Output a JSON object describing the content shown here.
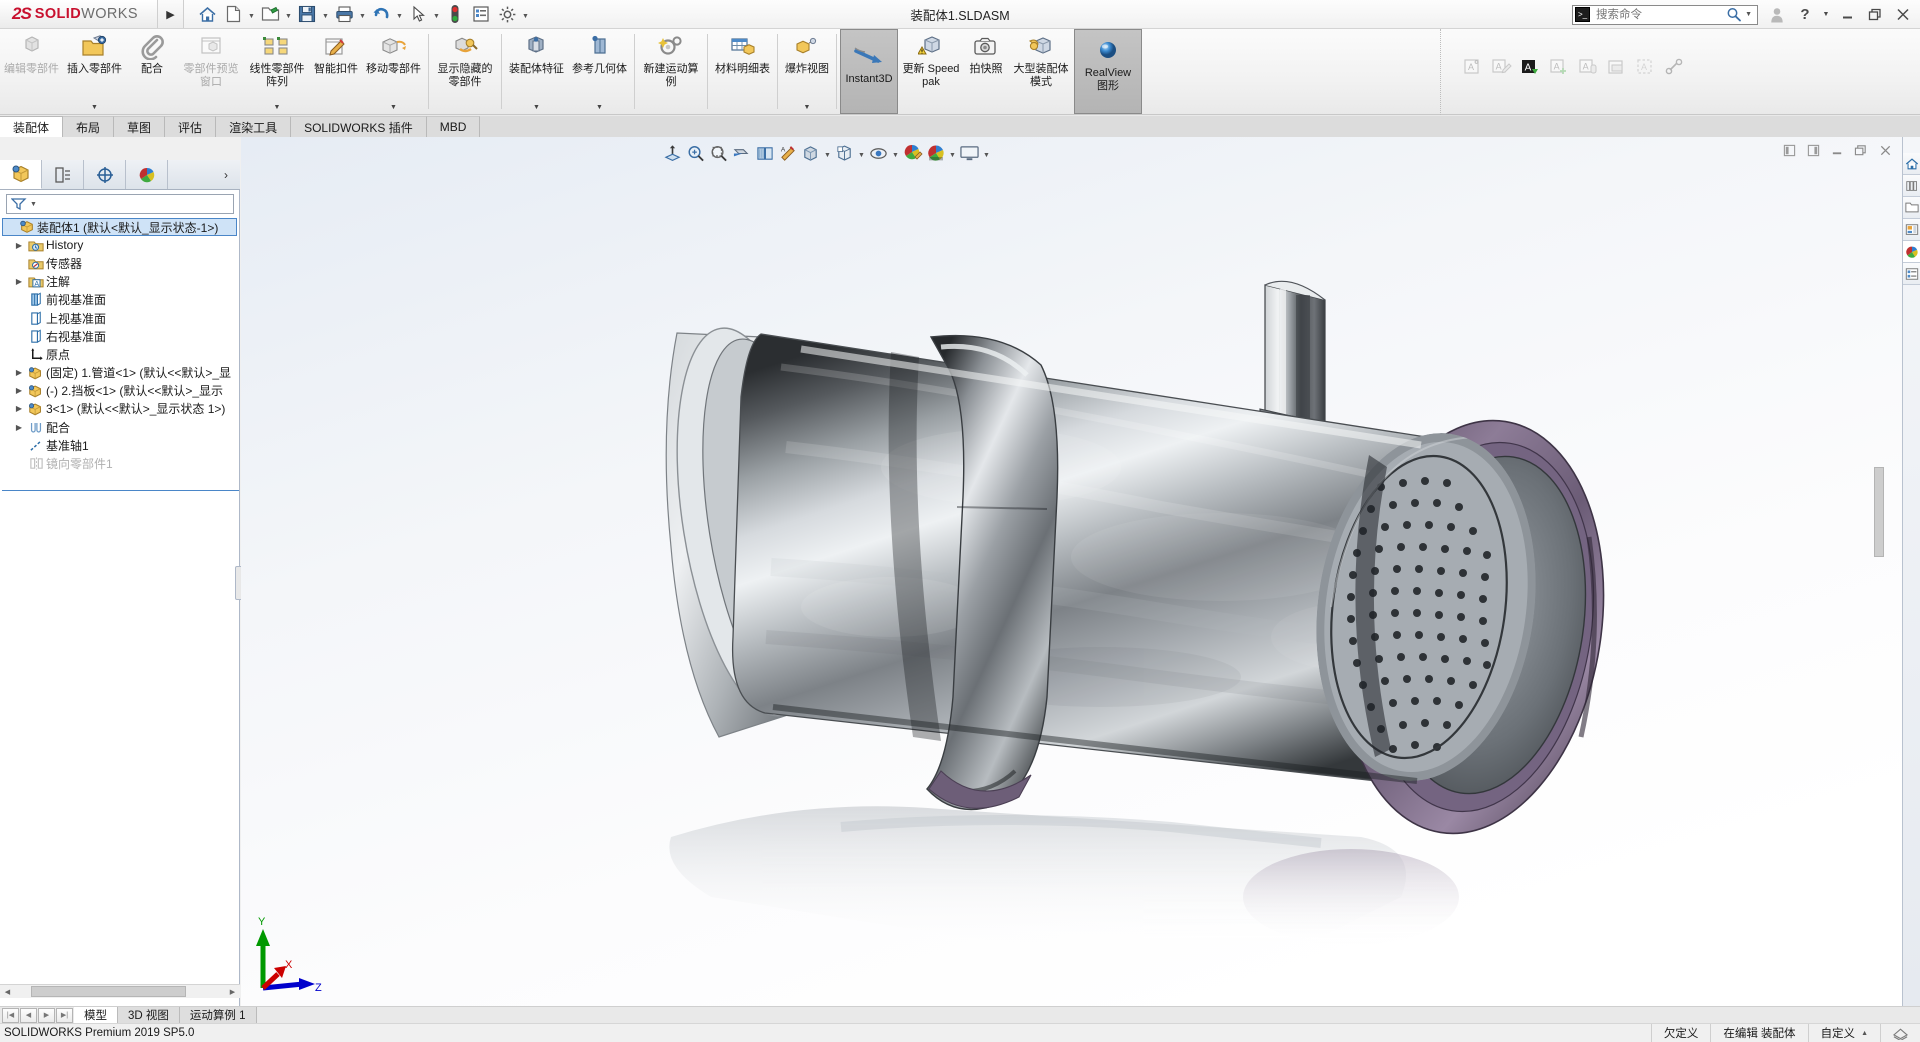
{
  "app": {
    "brand_ds": "2S",
    "brand_part1": "SOLID",
    "brand_part2": "WORKS",
    "document_title": "装配体1.SLDASM",
    "version_text": "SOLIDWORKS Premium 2019 SP5.0"
  },
  "quick_access": [
    {
      "name": "home-icon",
      "label": "主页"
    },
    {
      "name": "new-document-icon",
      "label": "新建"
    },
    {
      "name": "open-icon",
      "label": "打开"
    },
    {
      "name": "save-icon",
      "label": "保存"
    },
    {
      "name": "print-icon",
      "label": "打印"
    },
    {
      "name": "undo-icon",
      "label": "撤销"
    },
    {
      "name": "select-cursor-icon",
      "label": "选择"
    },
    {
      "name": "rebuild-icon",
      "label": "重建模型"
    },
    {
      "name": "options-list-icon",
      "label": "文件属性"
    },
    {
      "name": "gear-icon",
      "label": "选项"
    }
  ],
  "search": {
    "placeholder": "搜索命令",
    "value": ""
  },
  "window_controls": {
    "profile": "用户",
    "help": "?",
    "minimize": "—",
    "restore": "❐",
    "close": "✕"
  },
  "ribbon": {
    "groups": [
      {
        "items": [
          {
            "label": "编辑零部件",
            "icon": "edit-component-icon",
            "disabled": true,
            "dropdown": false,
            "selected": false
          },
          {
            "label": "插入零部件",
            "icon": "insert-component-icon",
            "disabled": false,
            "dropdown": true,
            "selected": false
          },
          {
            "label": "配合",
            "icon": "mate-paperclip-icon",
            "disabled": false,
            "dropdown": false,
            "selected": false
          },
          {
            "label": "零部件预览窗口",
            "icon": "component-preview-icon",
            "disabled": true,
            "dropdown": false,
            "selected": false
          },
          {
            "label": "线性零部件阵列",
            "icon": "linear-component-pattern-icon",
            "disabled": false,
            "dropdown": true,
            "selected": false
          },
          {
            "label": "智能扣件",
            "icon": "smart-fasteners-icon",
            "disabled": false,
            "dropdown": false,
            "selected": false
          },
          {
            "label": "移动零部件",
            "icon": "move-component-icon",
            "disabled": false,
            "dropdown": true,
            "selected": false
          }
        ]
      },
      {
        "items": [
          {
            "label": "显示隐藏的零部件",
            "icon": "show-hidden-components-icon",
            "disabled": false,
            "dropdown": false,
            "selected": false
          }
        ]
      },
      {
        "items": [
          {
            "label": "装配体特征",
            "icon": "assembly-feature-icon",
            "disabled": false,
            "dropdown": true,
            "selected": false
          },
          {
            "label": "参考几何体",
            "icon": "reference-geometry-icon",
            "disabled": false,
            "dropdown": true,
            "selected": false
          }
        ]
      },
      {
        "items": [
          {
            "label": "新建运动算例",
            "icon": "new-motion-study-icon",
            "disabled": false,
            "dropdown": false,
            "selected": false
          }
        ]
      },
      {
        "items": [
          {
            "label": "材料明细表",
            "icon": "bill-of-materials-icon",
            "disabled": false,
            "dropdown": false,
            "selected": false
          }
        ]
      },
      {
        "items": [
          {
            "label": "爆炸视图",
            "icon": "exploded-view-icon",
            "disabled": false,
            "dropdown": true,
            "selected": false
          }
        ]
      },
      {
        "items": [
          {
            "label": "Instant3D",
            "icon": "instant3d-icon",
            "disabled": false,
            "dropdown": false,
            "selected": true
          }
        ]
      },
      {
        "items": [
          {
            "label": "更新 Speedpak",
            "icon": "update-speedpak-icon",
            "disabled": false,
            "dropdown": false,
            "selected": false
          },
          {
            "label": "拍快照",
            "icon": "take-snapshot-icon",
            "disabled": false,
            "dropdown": false,
            "selected": false
          },
          {
            "label": "大型装配体模式",
            "icon": "large-assembly-mode-icon",
            "disabled": false,
            "dropdown": false,
            "selected": false
          },
          {
            "label": "RealView 图形",
            "icon": "realview-graphics-icon",
            "disabled": false,
            "dropdown": false,
            "selected": true
          }
        ]
      }
    ],
    "annotation_tools": [
      {
        "name": "new-note-icon",
        "disabled": true
      },
      {
        "name": "edit-note-icon",
        "disabled": true
      },
      {
        "name": "auto-note-icon",
        "disabled": false
      },
      {
        "name": "add-note-icon",
        "disabled": true
      },
      {
        "name": "note-properties-icon",
        "disabled": true
      },
      {
        "name": "print-note-icon",
        "disabled": true
      },
      {
        "name": "note-area-icon",
        "disabled": true
      },
      {
        "name": "link-note-icon",
        "disabled": true
      }
    ]
  },
  "command_tabs": [
    {
      "label": "装配体",
      "active": true
    },
    {
      "label": "布局",
      "active": false
    },
    {
      "label": "草图",
      "active": false
    },
    {
      "label": "评估",
      "active": false
    },
    {
      "label": "渲染工具",
      "active": false
    },
    {
      "label": "SOLIDWORKS 插件",
      "active": false
    },
    {
      "label": "MBD",
      "active": false
    }
  ],
  "feature_manager": {
    "tabs": [
      {
        "name": "feature-tree-tab",
        "label": "FeatureManager 设计树",
        "active": true
      },
      {
        "name": "property-manager-tab",
        "label": "PropertyManager",
        "active": false
      },
      {
        "name": "configuration-manager-tab",
        "label": "ConfigurationManager",
        "active": false
      },
      {
        "name": "display-manager-tab",
        "label": "DisplayManager",
        "active": false
      }
    ],
    "filter_placeholder": "",
    "tree": [
      {
        "label": "装配体1  (默认<默认_显示状态-1>)",
        "icon": "assembly-icon",
        "indent": 0,
        "expand": "",
        "selected": true,
        "greyed": false
      },
      {
        "label": "History",
        "icon": "history-icon",
        "indent": 1,
        "expand": "▶",
        "selected": false,
        "greyed": false
      },
      {
        "label": "传感器",
        "icon": "sensors-icon",
        "indent": 1,
        "expand": "",
        "selected": false,
        "greyed": false
      },
      {
        "label": "注解",
        "icon": "annotations-icon",
        "indent": 1,
        "expand": "▶",
        "selected": false,
        "greyed": false
      },
      {
        "label": "前视基准面",
        "icon": "plane-front-icon",
        "indent": 1,
        "expand": "",
        "selected": false,
        "greyed": false
      },
      {
        "label": "上视基准面",
        "icon": "plane-top-icon",
        "indent": 1,
        "expand": "",
        "selected": false,
        "greyed": false
      },
      {
        "label": "右视基准面",
        "icon": "plane-right-icon",
        "indent": 1,
        "expand": "",
        "selected": false,
        "greyed": false
      },
      {
        "label": "原点",
        "icon": "origin-icon",
        "indent": 1,
        "expand": "",
        "selected": false,
        "greyed": false
      },
      {
        "label": "(固定) 1.管道<1>  (默认<<默认>_显",
        "icon": "component-icon",
        "indent": 1,
        "expand": "▶",
        "selected": false,
        "greyed": false
      },
      {
        "label": "(-) 2.挡板<1>  (默认<<默认>_显示",
        "icon": "component-icon",
        "indent": 1,
        "expand": "▶",
        "selected": false,
        "greyed": false
      },
      {
        "label": "3<1>  (默认<<默认>_显示状态 1>)",
        "icon": "component-icon",
        "indent": 1,
        "expand": "▶",
        "selected": false,
        "greyed": false
      },
      {
        "label": "配合",
        "icon": "mates-folder-icon",
        "indent": 1,
        "expand": "▶",
        "selected": false,
        "greyed": false
      },
      {
        "label": "基准轴1",
        "icon": "axis-icon",
        "indent": 1,
        "expand": "",
        "selected": false,
        "greyed": false
      },
      {
        "label": "镜向零部件1",
        "icon": "mirror-components-icon",
        "indent": 1,
        "expand": "",
        "selected": false,
        "greyed": true
      }
    ]
  },
  "heads_up_toolbar": [
    {
      "name": "zoom-to-fit-icon",
      "caret": false
    },
    {
      "name": "zoom-to-area-icon",
      "caret": false
    },
    {
      "name": "previous-view-icon",
      "caret": false
    },
    {
      "name": "section-view-icon",
      "caret": false
    },
    {
      "name": "view-orientation-icon",
      "caret": false
    },
    {
      "name": "apply-scene-icon",
      "caret": false
    },
    {
      "name": "display-style-icon",
      "caret": true
    },
    {
      "name": "hide-show-items-icon",
      "caret": true
    },
    {
      "name": "edit-appearance-icon",
      "caret": true
    },
    {
      "name": "apply-scene-ball-icon",
      "caret": true
    },
    {
      "name": "view-settings-icon",
      "caret": true
    }
  ],
  "doc_window_controls": [
    {
      "name": "tile-left-icon"
    },
    {
      "name": "tile-right-icon"
    },
    {
      "name": "doc-minimize-icon"
    },
    {
      "name": "doc-restore-icon"
    },
    {
      "name": "doc-close-icon"
    }
  ],
  "task_pane": [
    {
      "name": "solidworks-resources-home-icon",
      "active": false
    },
    {
      "name": "design-library-icon",
      "active": false
    },
    {
      "name": "file-explorer-icon",
      "active": false
    },
    {
      "name": "view-palette-icon",
      "active": false
    },
    {
      "name": "appearances-scenes-icon",
      "active": true
    },
    {
      "name": "custom-properties-icon",
      "active": false
    }
  ],
  "triad": {
    "y_label": "Y",
    "x_label": "X",
    "z_label": "Z",
    "y_color": "#009900",
    "x_color": "#cc0000",
    "z_color": "#0000cc"
  },
  "bottom_tabs": [
    {
      "label": "模型",
      "active": true
    },
    {
      "label": "3D 视图",
      "active": false
    },
    {
      "label": "运动算例 1",
      "active": false
    }
  ],
  "status_bar": {
    "left": "SOLIDWORKS Premium 2019 SP5.0",
    "under_defined": "欠定义",
    "editing": "在编辑 装配体",
    "custom": "自定义"
  },
  "colors": {
    "accent_red": "#c8102e",
    "selection_blue": "#cfe3f7",
    "selection_border": "#4a86c8",
    "ribbon_bg": "#f2f2f2",
    "metal_light": "#d8dce0",
    "metal_dark": "#2e3134",
    "flange_purple": "#7b6a86"
  }
}
